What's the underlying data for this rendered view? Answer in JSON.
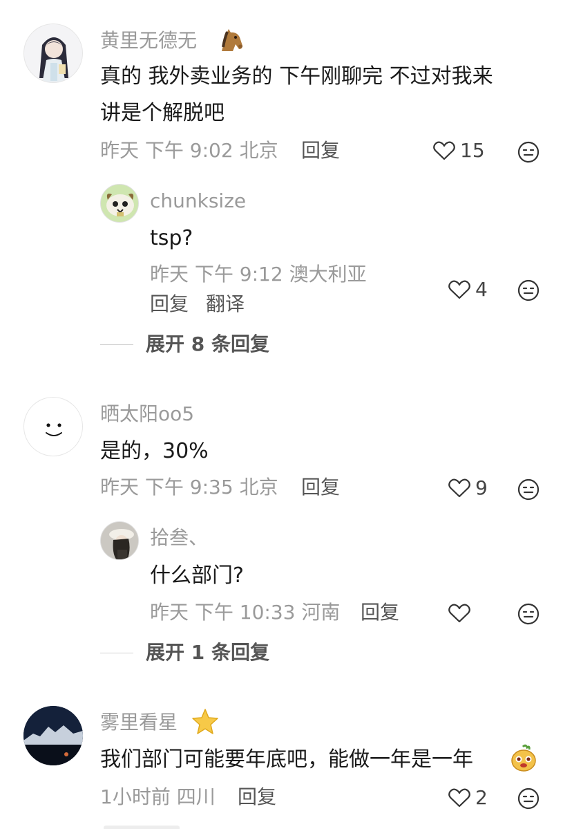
{
  "comments": [
    {
      "user": "黄里无德无",
      "text_line1": "真的 我外卖业务的  下午刚聊完 不过对我来",
      "text_line2": "讲是个解脱吧",
      "time": "昨天 下午 9:02 北京",
      "reply_label": "回复",
      "likes": "15",
      "replies": [
        {
          "user": "chunksize",
          "text": "tsp?",
          "time": "昨天 下午 9:12 澳大利亚",
          "reply_label": "回复",
          "translate_label": "翻译",
          "likes": "4"
        }
      ],
      "expand_label": "展开 8 条回复"
    },
    {
      "user": "晒太阳oo5",
      "text": "是的，30%",
      "time": "昨天 下午 9:35 北京",
      "reply_label": "回复",
      "likes": "9",
      "replies": [
        {
          "user": "拾叁、",
          "text": "什么部门?",
          "time": "昨天 下午 10:33 河南",
          "reply_label": "回复",
          "likes": ""
        }
      ],
      "expand_label": "展开 1 条回复"
    },
    {
      "user": "雾里看星",
      "text": "我们部门可能要年底吧，能做一年是一年",
      "time": "1小时前 四川",
      "reply_label": "回复",
      "likes": "2"
    }
  ],
  "icons": {
    "like": "heart-outline-icon",
    "emoji": "neutral-face-icon",
    "user1_badge": "horse-emoji",
    "user3_badge": "star-emoji",
    "comment3_emoji": "yellow-face-emoji"
  },
  "colors": {
    "meta": "#9a9a9a",
    "text": "#1a1a1a",
    "reply": "#555555"
  }
}
